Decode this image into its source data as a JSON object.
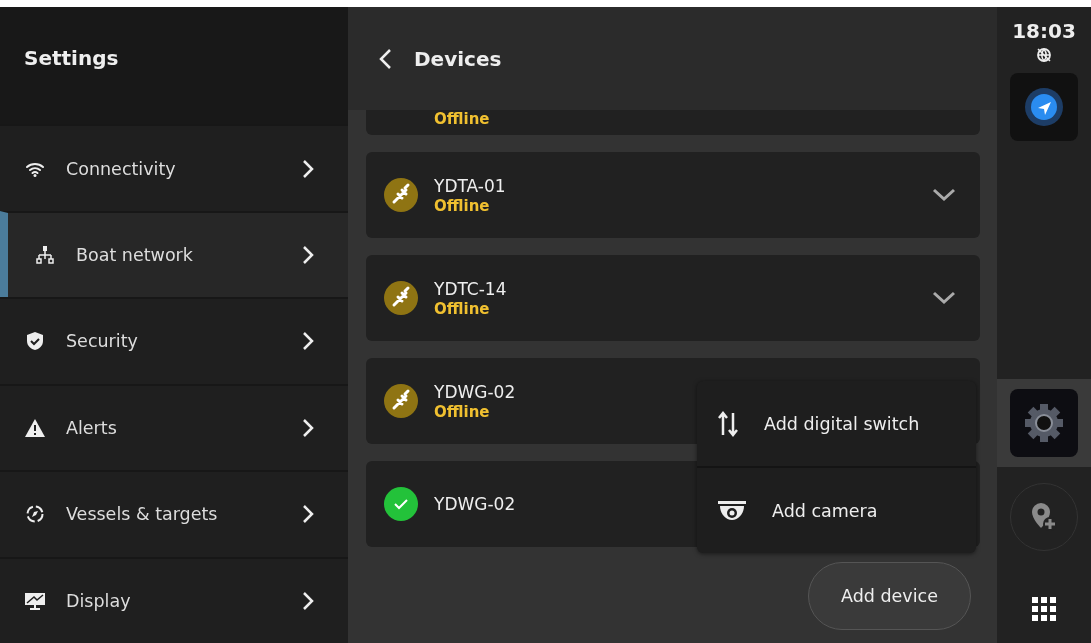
{
  "sidebar": {
    "title": "Settings",
    "items": [
      {
        "label": "Connectivity",
        "kind": "wifi",
        "selected": false
      },
      {
        "label": "Boat network",
        "kind": "network",
        "selected": true
      },
      {
        "label": "Security",
        "kind": "shield",
        "selected": false
      },
      {
        "label": "Alerts",
        "kind": "warning",
        "selected": false
      },
      {
        "label": "Vessels & targets",
        "kind": "target",
        "selected": false
      },
      {
        "label": "Display",
        "kind": "monitor",
        "selected": false
      }
    ]
  },
  "header": {
    "title": "Devices"
  },
  "devices": [
    {
      "status": "Offline"
    },
    {
      "name": "YDTA-01",
      "status": "Offline",
      "kind": "offline",
      "expandable": true
    },
    {
      "name": "YDTC-14",
      "status": "Offline",
      "kind": "offline",
      "expandable": true
    },
    {
      "name": "YDWG-02",
      "status": "Offline",
      "kind": "offline"
    },
    {
      "name": "YDWG-02",
      "kind": "online"
    }
  ],
  "menu": {
    "items": [
      {
        "label": "Add digital switch",
        "kind": "switch"
      },
      {
        "label": "Add camera",
        "kind": "camera"
      }
    ]
  },
  "add_button": "Add device",
  "rail": {
    "time": "18:03",
    "items": [
      {
        "kind": "navigation",
        "selected": false
      },
      {
        "kind": "settings",
        "selected": true
      },
      {
        "kind": "pin",
        "selected": false
      },
      {
        "kind": "apps",
        "selected": false
      }
    ]
  }
}
